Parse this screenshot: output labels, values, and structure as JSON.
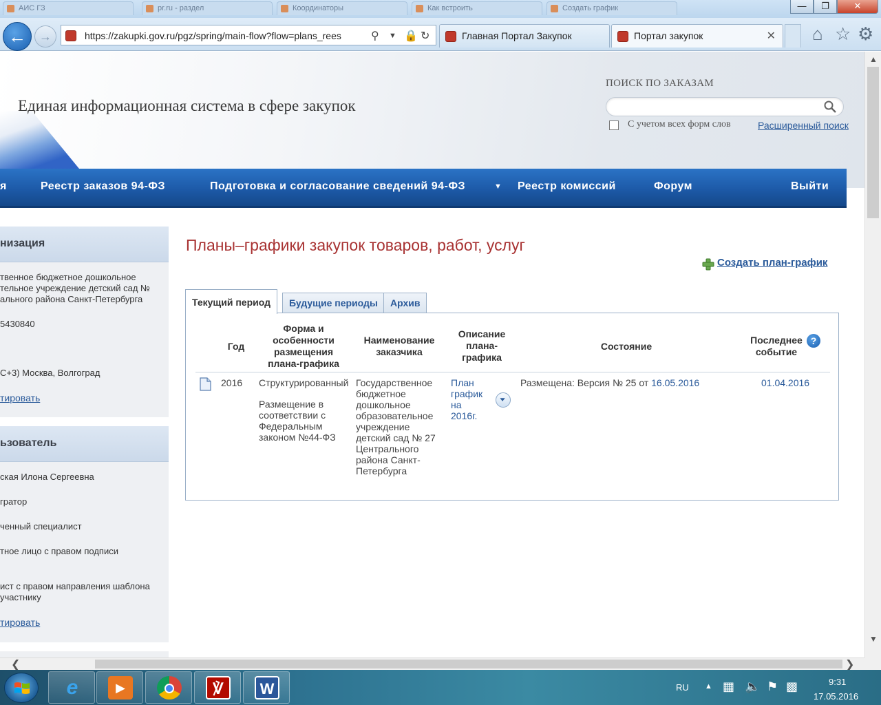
{
  "browser": {
    "url": "https://zakupki.gov.ru/pgz/spring/main-flow?flow=plans_rees",
    "tabs": [
      {
        "label": "Главная Портал Закупок",
        "active": false
      },
      {
        "label": "Портал закупок",
        "active": true
      }
    ],
    "bg_tabs": [
      "АИС ГЗ",
      "pr.ru - раздел",
      "Координаторы",
      "Как встроить",
      "Создать график"
    ]
  },
  "header": {
    "site_title": "Единая информационная система в сфере закупок",
    "search_label": "ПОИСК ПО ЗАКАЗАМ",
    "search_value": "",
    "all_forms_label": "С учетом всех форм слов",
    "all_forms_checked": false,
    "advanced_search": "Расширенный поиск"
  },
  "nav": {
    "items": [
      {
        "label": "я"
      },
      {
        "label": "Реестр заказов 94-ФЗ"
      },
      {
        "label": "Подготовка и согласование сведений 94-ФЗ"
      },
      {
        "label": "Реестр комиссий"
      },
      {
        "label": "Форум"
      },
      {
        "label": "Выйти"
      }
    ]
  },
  "sidebar": {
    "org": {
      "title": "низация",
      "name_lines": [
        "твенное бюджетное дошкольное",
        "тельное учреждение детский сад №",
        "ального района Санкт-Петербурга"
      ],
      "code": "5430840",
      "timezone": "С+3) Москва, Волгоград",
      "edit_link": "тировать"
    },
    "user": {
      "title": "ьзователь",
      "name": "ская Илона Сергеевна",
      "roles": [
        "гратор",
        "ченный специалист",
        "тное лицо с правом подписи"
      ],
      "role_multi": [
        "ист с правом направления шаблона",
        "участнику"
      ],
      "edit_link": "тировать"
    }
  },
  "main": {
    "title": "Планы–графики закупок товаров, работ, услуг",
    "create_link": "Создать план-график",
    "tabs": [
      {
        "label": "Текущий период",
        "active": true
      },
      {
        "label": "Будущие периоды",
        "active": false
      },
      {
        "label": "Архив",
        "active": false
      }
    ],
    "table": {
      "headers": {
        "year": "Год",
        "form": [
          "Форма и",
          "особенности",
          "размещения",
          "плана-графика"
        ],
        "customer": [
          "Наименование",
          "заказчика"
        ],
        "description": [
          "Описание",
          "плана-",
          "графика"
        ],
        "state": "Состояние",
        "last_event": [
          "Последнее",
          "событие"
        ]
      },
      "row": {
        "year": "2016",
        "form_type": "Структурированный",
        "form_details": [
          "Размещение в",
          "соответствии с",
          "Федеральным",
          "законом №44-ФЗ"
        ],
        "customer": [
          "Государственное",
          "бюджетное",
          "дошкольное",
          "образовательное",
          "учреждение",
          "детский сад № 27",
          "Центрального",
          "района Санкт-",
          "Петербурга"
        ],
        "description_link": [
          "План",
          "график",
          "на",
          "2016г."
        ],
        "state_prefix": "Размещена: Версия №  25 от ",
        "state_date": "16.05.2016",
        "last_event": "01.04.2016"
      }
    }
  },
  "taskbar": {
    "lang": "RU",
    "time": "9:31",
    "date": "17.05.2016",
    "apps": [
      "internet-explorer",
      "media-player",
      "chrome",
      "acrobat",
      "word"
    ]
  }
}
